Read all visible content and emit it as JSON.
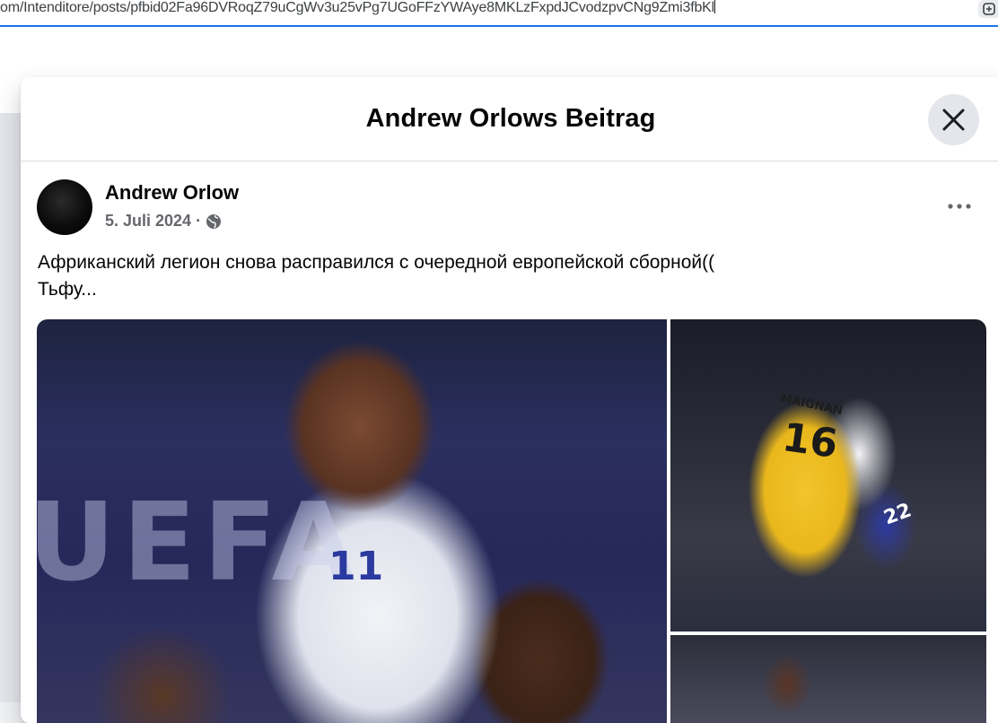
{
  "browser": {
    "url": "om/Intenditore/posts/pfbid02Fa96DVRoqZ79uCgWv3u25vPg7UGoFFzYWAye8MKLzFxpdJCvodzpvCNg9Zmi3fbKl"
  },
  "modal": {
    "title": "Andrew Orlows Beitrag",
    "close_icon": "close-icon"
  },
  "post": {
    "author": "Andrew Orlow",
    "date": "5. Juli 2024",
    "separator": "·",
    "privacy_icon": "globe-icon",
    "more_icon": "more-options-icon",
    "text": "Африканский легион снова расправился с очередной европейской сборной((\nТьфу...",
    "photos": [
      {
        "overlay_text": "UEFA",
        "jersey_number": "11"
      },
      {
        "jersey_name": "MAIGNAN",
        "jersey_number": "16",
        "second_number": "22"
      },
      {}
    ]
  },
  "colors": {
    "accent": "#1a73e8",
    "secondary_text": "#65676b",
    "button_bg": "#e4e6eb"
  }
}
